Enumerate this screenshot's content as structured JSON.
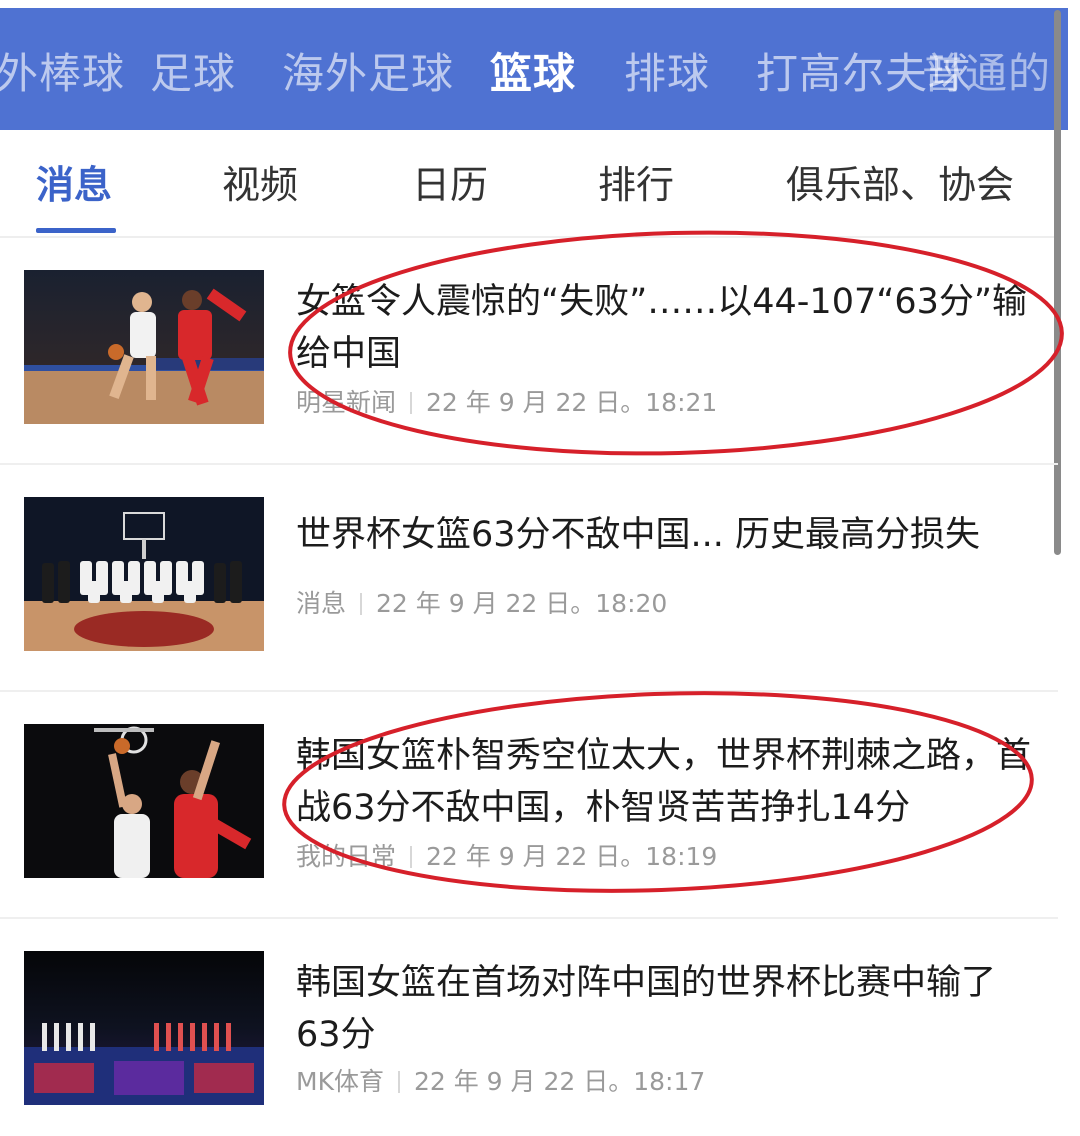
{
  "sport_tabs": [
    {
      "label": "外棒球",
      "active": false
    },
    {
      "label": "足球",
      "active": false
    },
    {
      "label": "海外足球",
      "active": false
    },
    {
      "label": "篮球",
      "active": true
    },
    {
      "label": "排球",
      "active": false
    },
    {
      "label": "打高尔夫球",
      "active": false
    },
    {
      "label": "普通的",
      "active": false
    }
  ],
  "sub_tabs": [
    {
      "label": "消息",
      "active": true
    },
    {
      "label": "视频",
      "active": false
    },
    {
      "label": "日历",
      "active": false
    },
    {
      "label": "排行",
      "active": false
    },
    {
      "label": "俱乐部、协会",
      "active": false
    }
  ],
  "news": [
    {
      "title": "女篮令人震惊的“失败”……以44-107“63分”输给中国",
      "source": "明星新闻",
      "time": "22 年 9 月 22 日。18:21",
      "thumbnail": "basketball-drive-photo",
      "circled": true
    },
    {
      "title": "世界杯女篮63分不敌中国... 历史最高分损失",
      "source": "消息",
      "time": "22 年 9 月 22 日。18:20",
      "thumbnail": "team-photo",
      "circled": false
    },
    {
      "title": "韩国女篮朴智秀空位太大，世界杯荆棘之路，首战63分不敌中国，朴智贤苦苦挣扎14分",
      "source": "我的日常",
      "time": "22 年 9 月 22 日。18:19",
      "thumbnail": "basketball-layup-photo",
      "circled": true
    },
    {
      "title": "韩国女篮在首场对阵中国的世界杯比赛中输了63分",
      "source": "MK体育",
      "time": "22 年 9 月 22 日。18:17",
      "thumbnail": "arena-lineup-photo",
      "circled": false
    }
  ],
  "colors": {
    "header_blue": "#4f72d2",
    "active_tab": "#3b63c9",
    "annotation_red": "#d6202a"
  }
}
